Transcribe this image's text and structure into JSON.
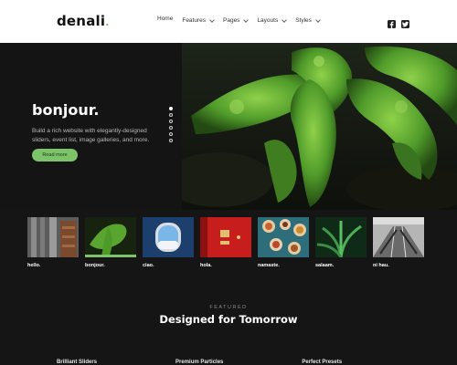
{
  "header": {
    "logo": "denali",
    "logo_dot": ".",
    "nav": [
      {
        "label": "Home",
        "dropdown": false
      },
      {
        "label": "Features",
        "dropdown": true
      },
      {
        "label": "Pages",
        "dropdown": true
      },
      {
        "label": "Layouts",
        "dropdown": true
      },
      {
        "label": "Styles",
        "dropdown": true
      }
    ],
    "social_icons": [
      "facebook-icon",
      "twitter-icon"
    ]
  },
  "hero": {
    "title": "bonjour.",
    "subtitle": "Build a rich website with elegantly-designed sliders, event list, image galleries, and more.",
    "button_label": "Read more",
    "slide_count": 6,
    "active_slide": 1
  },
  "thumbnails": [
    {
      "caption": "hello.",
      "active": false
    },
    {
      "caption": "bonjour.",
      "active": true
    },
    {
      "caption": "ciao.",
      "active": false
    },
    {
      "caption": "hola.",
      "active": false
    },
    {
      "caption": "namaste.",
      "active": false
    },
    {
      "caption": "salaam.",
      "active": false
    },
    {
      "caption": "ni hau.",
      "active": false
    }
  ],
  "featured": {
    "eyebrow": "FEATURED",
    "title": "Designed for Tomorrow",
    "items": [
      "Brilliant Sliders",
      "Premium Particles",
      "Perfect Presets"
    ]
  },
  "colors": {
    "accent": "#7cc36a",
    "background": "#151515",
    "header_bg": "#ffffff"
  }
}
